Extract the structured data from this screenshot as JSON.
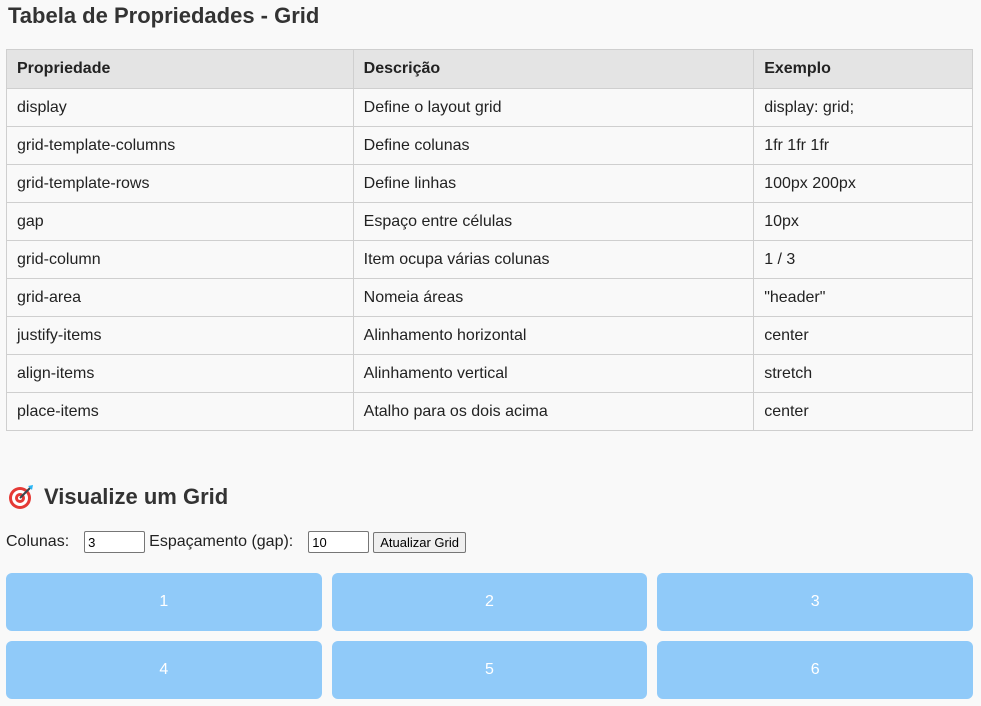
{
  "title": "Tabela de Propriedades - Grid",
  "table": {
    "headers": [
      "Propriedade",
      "Descrição",
      "Exemplo"
    ],
    "rows": [
      [
        "display",
        "Define o layout grid",
        "display: grid;"
      ],
      [
        "grid-template-columns",
        "Define colunas",
        "1fr 1fr 1fr"
      ],
      [
        "grid-template-rows",
        "Define linhas",
        "100px 200px"
      ],
      [
        "gap",
        "Espaço entre células",
        "10px"
      ],
      [
        "grid-column",
        "Item ocupa várias colunas",
        "1 / 3"
      ],
      [
        "grid-area",
        "Nomeia áreas",
        "\"header\""
      ],
      [
        "justify-items",
        "Alinhamento horizontal",
        "center"
      ],
      [
        "align-items",
        "Alinhamento vertical",
        "stretch"
      ],
      [
        "place-items",
        "Atalho para os dois acima",
        "center"
      ]
    ]
  },
  "visualize": {
    "icon": "target-icon",
    "heading": "Visualize um Grid",
    "columns_label": "Colunas:",
    "columns_value": "3",
    "gap_label": "Espaçamento (gap):",
    "gap_value": "10",
    "update_button": "Atualizar Grid",
    "cells": [
      "1",
      "2",
      "3",
      "4",
      "5",
      "6"
    ]
  },
  "colors": {
    "cell_bg": "#90caf9",
    "header_bg": "#e4e4e4",
    "page_bg": "#f9f9f9"
  }
}
